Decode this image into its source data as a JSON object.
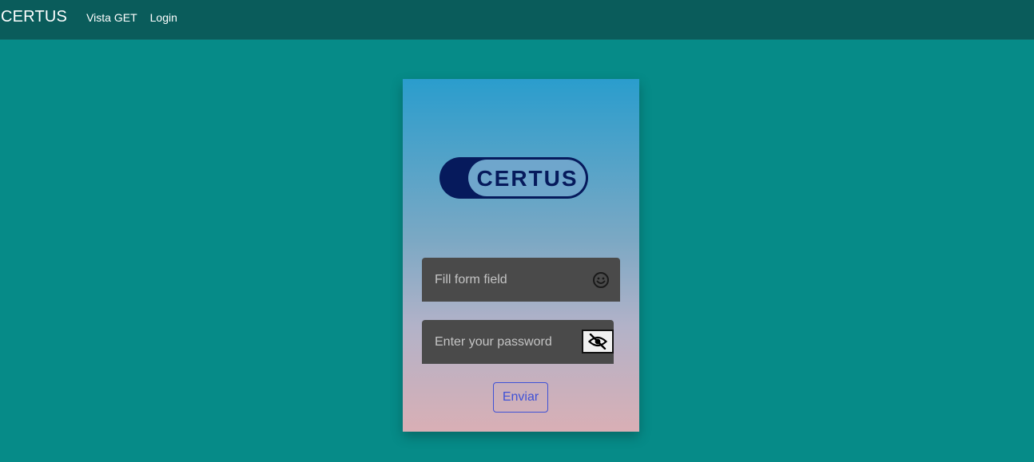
{
  "navbar": {
    "brand": "CERTUS",
    "links": [
      "Vista GET",
      "Login"
    ]
  },
  "login_card": {
    "logo_text": "CERTUS",
    "username_placeholder": "Fill form field",
    "password_placeholder": "Enter your password",
    "submit_label": "Enviar",
    "icons": {
      "username": "smile-icon",
      "password": "eye-off-icon"
    }
  },
  "colors": {
    "page_background": "#068b88",
    "navbar_background": "#0a5c5b",
    "card_gradient_top": "#2a9dcd",
    "card_gradient_bottom": "#d9afb5",
    "field_background": "#4a4a4a",
    "logo_navy": "#061a5c",
    "logo_pill_fill": "#6fa6cc",
    "submit_accent": "#3f51d6"
  }
}
